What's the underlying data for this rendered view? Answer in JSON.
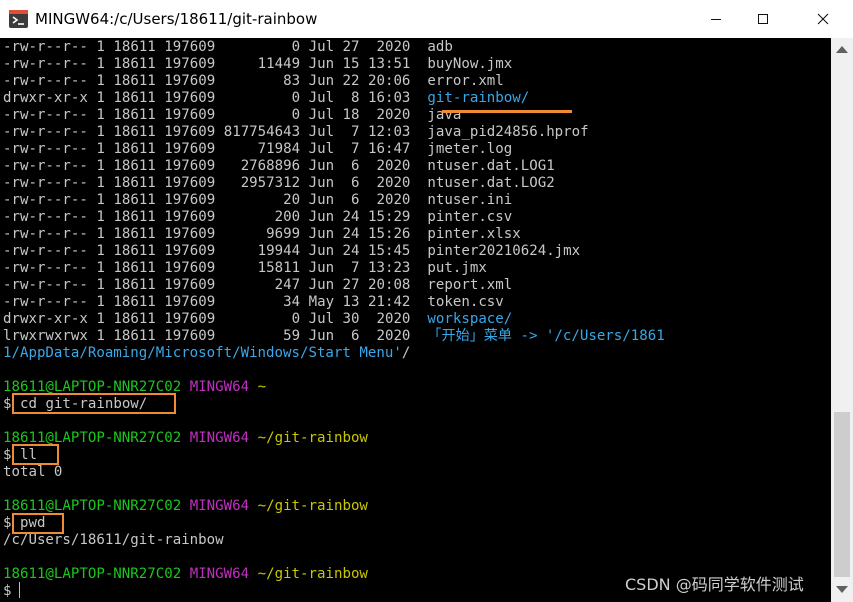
{
  "window": {
    "title": "MINGW64:/c/Users/18611/git-rainbow",
    "controls": {
      "minimize": "—",
      "maximize": "☐",
      "close": "✕"
    }
  },
  "listing": [
    {
      "perm": "-rw-r--r--",
      "links": "1",
      "user": "18611",
      "group": "197609",
      "size": "0",
      "date": "Jul 27  2020",
      "name": "adb",
      "name_color": "#c7c7c7"
    },
    {
      "perm": "-rw-r--r--",
      "links": "1",
      "user": "18611",
      "group": "197609",
      "size": "11449",
      "date": "Jun 15 13:51",
      "name": "buyNow.jmx",
      "name_color": "#c7c7c7"
    },
    {
      "perm": "-rw-r--r--",
      "links": "1",
      "user": "18611",
      "group": "197609",
      "size": "83",
      "date": "Jun 22 20:06",
      "name": "error.xml",
      "name_color": "#c7c7c7"
    },
    {
      "perm": "drwxr-xr-x",
      "links": "1",
      "user": "18611",
      "group": "197609",
      "size": "0",
      "date": "Jul  8 16:03",
      "name": "git-rainbow/",
      "name_color": "#3aa7e8"
    },
    {
      "perm": "-rw-r--r--",
      "links": "1",
      "user": "18611",
      "group": "197609",
      "size": "0",
      "date": "Jul 18  2020",
      "name": "java",
      "name_color": "#c7c7c7"
    },
    {
      "perm": "-rw-r--r--",
      "links": "1",
      "user": "18611",
      "group": "197609",
      "size": "817754643",
      "date": "Jul  7 12:03",
      "name": "java_pid24856.hprof",
      "name_color": "#c7c7c7"
    },
    {
      "perm": "-rw-r--r--",
      "links": "1",
      "user": "18611",
      "group": "197609",
      "size": "71984",
      "date": "Jul  7 16:47",
      "name": "jmeter.log",
      "name_color": "#c7c7c7"
    },
    {
      "perm": "-rw-r--r--",
      "links": "1",
      "user": "18611",
      "group": "197609",
      "size": "2768896",
      "date": "Jun  6  2020",
      "name": "ntuser.dat.LOG1",
      "name_color": "#c7c7c7"
    },
    {
      "perm": "-rw-r--r--",
      "links": "1",
      "user": "18611",
      "group": "197609",
      "size": "2957312",
      "date": "Jun  6  2020",
      "name": "ntuser.dat.LOG2",
      "name_color": "#c7c7c7"
    },
    {
      "perm": "-rw-r--r--",
      "links": "1",
      "user": "18611",
      "group": "197609",
      "size": "20",
      "date": "Jun  6  2020",
      "name": "ntuser.ini",
      "name_color": "#c7c7c7"
    },
    {
      "perm": "-rw-r--r--",
      "links": "1",
      "user": "18611",
      "group": "197609",
      "size": "200",
      "date": "Jun 24 15:29",
      "name": "pinter.csv",
      "name_color": "#c7c7c7"
    },
    {
      "perm": "-rw-r--r--",
      "links": "1",
      "user": "18611",
      "group": "197609",
      "size": "9699",
      "date": "Jun 24 15:26",
      "name": "pinter.xlsx",
      "name_color": "#c7c7c7"
    },
    {
      "perm": "-rw-r--r--",
      "links": "1",
      "user": "18611",
      "group": "197609",
      "size": "19944",
      "date": "Jun 24 15:45",
      "name": "pinter20210624.jmx",
      "name_color": "#c7c7c7"
    },
    {
      "perm": "-rw-r--r--",
      "links": "1",
      "user": "18611",
      "group": "197609",
      "size": "15811",
      "date": "Jun  7 13:23",
      "name": "put.jmx",
      "name_color": "#c7c7c7"
    },
    {
      "perm": "-rw-r--r--",
      "links": "1",
      "user": "18611",
      "group": "197609",
      "size": "247",
      "date": "Jun 27 20:08",
      "name": "report.xml",
      "name_color": "#c7c7c7"
    },
    {
      "perm": "-rw-r--r--",
      "links": "1",
      "user": "18611",
      "group": "197609",
      "size": "34",
      "date": "May 13 21:42",
      "name": "token.csv",
      "name_color": "#c7c7c7"
    },
    {
      "perm": "drwxr-xr-x",
      "links": "1",
      "user": "18611",
      "group": "197609",
      "size": "0",
      "date": "Jul 30  2020",
      "name": "workspace/",
      "name_color": "#3aa7e8"
    },
    {
      "perm": "lrwxrwxrwx",
      "links": "1",
      "user": "18611",
      "group": "197609",
      "size": "59",
      "date": "Jun  6  2020",
      "name": "「开始」菜单 -> '/c/Users/1861",
      "name_color": "#3aa7e8"
    }
  ],
  "wrap_line": "1/AppData/Roaming/Microsoft/Windows/Start Menu'",
  "wrap_suffix": "/",
  "sessions": [
    {
      "user_host": "18611@LAPTOP-NNR27C02",
      "shell": "MINGW64",
      "path": "~",
      "command": "cd git-rainbow/",
      "output": ""
    },
    {
      "user_host": "18611@LAPTOP-NNR27C02",
      "shell": "MINGW64",
      "path": "~/git-rainbow",
      "command": "ll",
      "output": "total 0"
    },
    {
      "user_host": "18611@LAPTOP-NNR27C02",
      "shell": "MINGW64",
      "path": "~/git-rainbow",
      "command": "pwd",
      "output": "/c/Users/18611/git-rainbow"
    },
    {
      "user_host": "18611@LAPTOP-NNR27C02",
      "shell": "MINGW64",
      "path": "~/git-rainbow",
      "command": "",
      "output": ""
    }
  ],
  "prompt_symbol": "$",
  "watermark": "CSDN @码同学软件测试",
  "colors": {
    "highlight": "#ef8a35",
    "user_host": "#1cc71c",
    "shell": "#c030c0",
    "path": "#c8c800",
    "dir": "#3aa7e8"
  }
}
